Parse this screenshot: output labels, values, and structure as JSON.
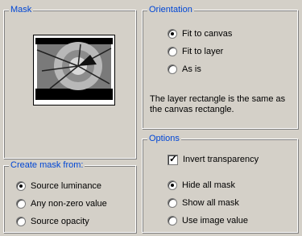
{
  "mask": {
    "title": "Mask",
    "thumbnail_icon": "mask-preview-image"
  },
  "orientation": {
    "title": "Orientation",
    "options": [
      {
        "label": "Fit to canvas",
        "checked": true
      },
      {
        "label": "Fit to layer",
        "checked": false
      },
      {
        "label": "As is",
        "checked": false
      }
    ],
    "note": "The layer rectangle is the same as the canvas rectangle."
  },
  "create_mask": {
    "title": "Create mask from:",
    "options": [
      {
        "label": "Source luminance",
        "checked": true
      },
      {
        "label": "Any non-zero value",
        "checked": false
      },
      {
        "label": "Source opacity",
        "checked": false
      }
    ]
  },
  "options": {
    "title": "Options",
    "invert_label": "Invert transparency",
    "invert_checked": true,
    "radios": [
      {
        "label": "Hide all mask",
        "checked": true
      },
      {
        "label": "Show all mask",
        "checked": false
      },
      {
        "label": "Use image value",
        "checked": false
      }
    ]
  }
}
